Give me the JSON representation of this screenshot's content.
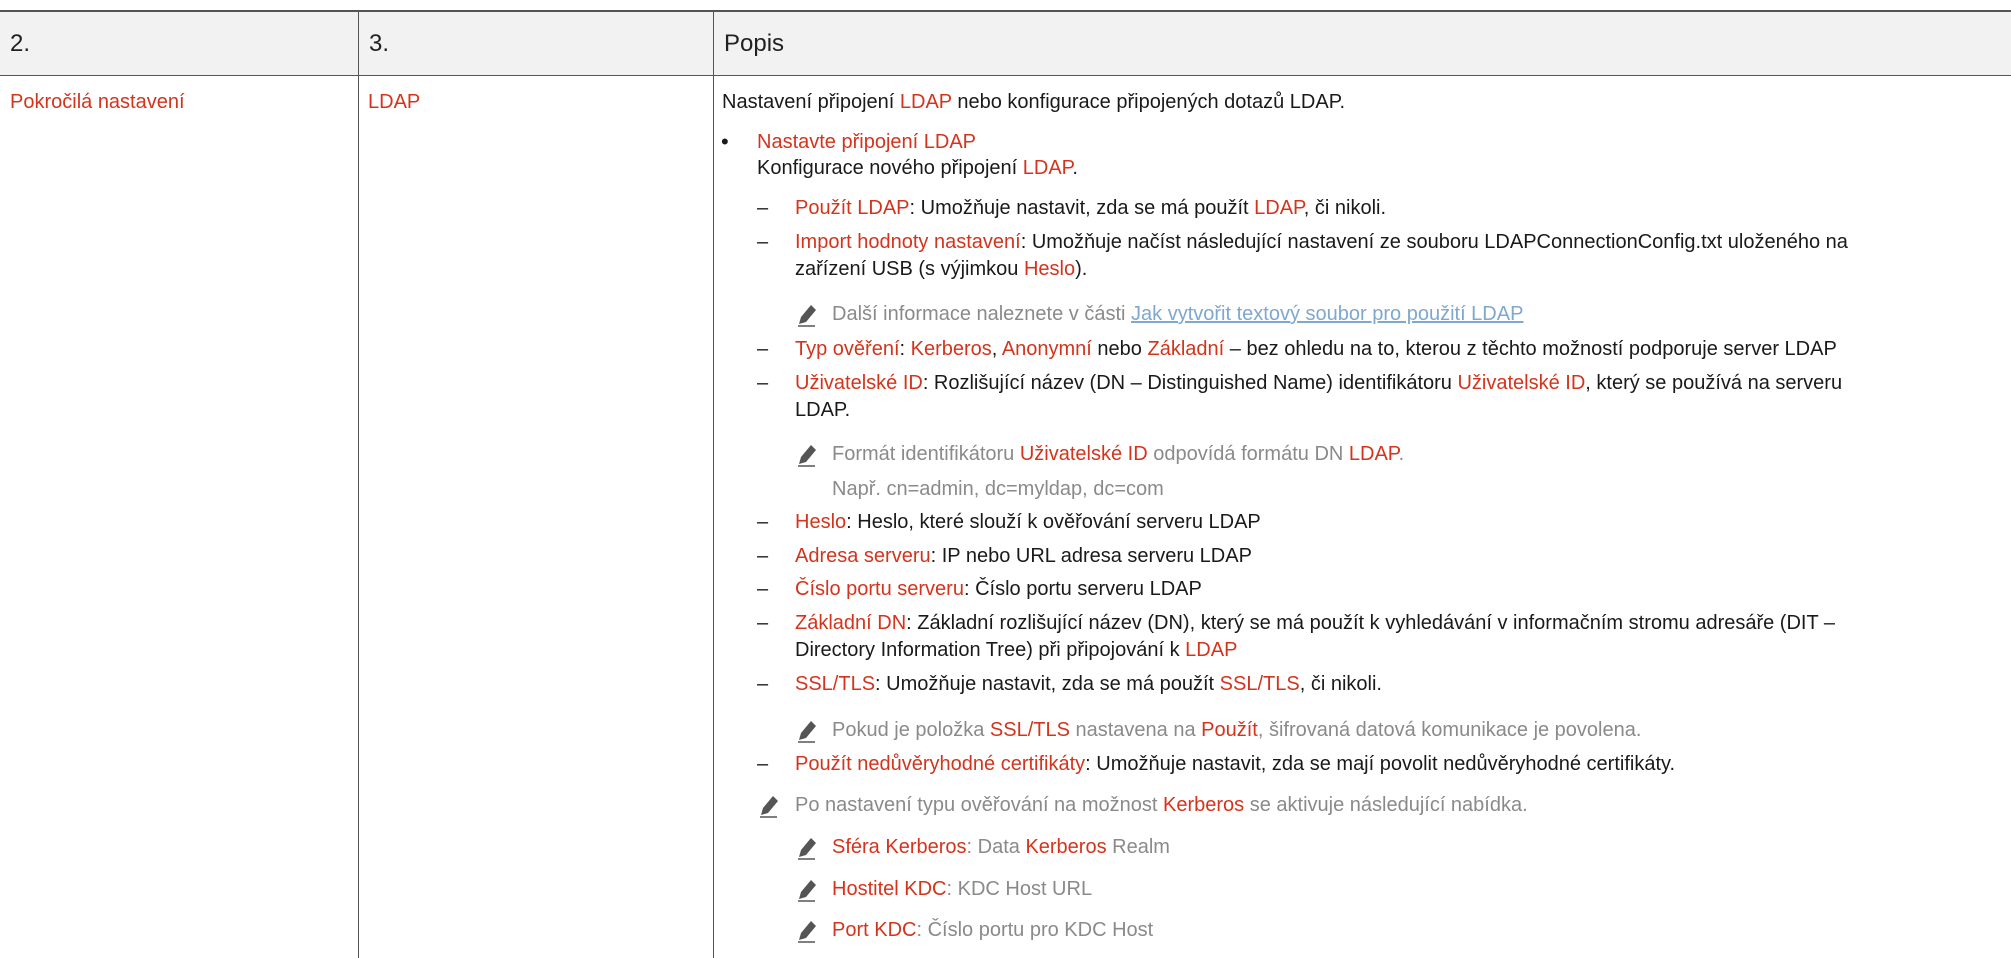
{
  "table": {
    "headers": [
      "2.",
      "3.",
      "Popis"
    ],
    "col1": "Pokročilá nastavení",
    "col2": "LDAP"
  },
  "desc": {
    "intro": {
      "a": "Nastavení připojení ",
      "b": "LDAP",
      "c": " nebo konfigurace připojených dotazů LDAP."
    },
    "bullet_title": "Nastavte připojení LDAP",
    "bullet_sub": {
      "a": "Konfigurace nového připojení ",
      "b": "LDAP",
      "c": "."
    },
    "use_ldap": {
      "a": "Použít LDAP",
      "b": ": Umožňuje nastavit, zda se má použít ",
      "c": "LDAP",
      "d": ", či nikoli."
    },
    "import": {
      "a": "Import hodnoty nastavení",
      "b": ": Umožňuje načíst následující nastavení ze souboru LDAPConnectionConfig.txt uloženého na",
      "c": "zařízení USB (s výjimkou ",
      "d": "Heslo",
      "e": ")."
    },
    "note_more": {
      "a": "Další informace naleznete v části ",
      "link": "Jak vytvořit textový soubor pro použití LDAP"
    },
    "auth": {
      "a": "Typ ověření",
      "b": ": ",
      "c": "Kerberos",
      "d": ", ",
      "e": "Anonymní",
      "f": " nebo ",
      "g": "Základní",
      "h": " – bez ohledu na to, kterou z těchto možností podporuje server LDAP"
    },
    "userid": {
      "a": "Uživatelské ID",
      "b": ": Rozlišující název (DN – Distinguished Name) identifikátoru ",
      "c": "Uživatelské ID",
      "d": ", který se používá na serveru",
      "e": "LDAP."
    },
    "note_format": {
      "a": "Formát identifikátoru ",
      "b": "Uživatelské ID",
      "c": " odpovídá formátu DN ",
      "d": "LDAP",
      "e": ".",
      "example": "Např. cn=admin, dc=myldap, dc=com"
    },
    "password": {
      "a": "Heslo",
      "b": ": Heslo, které slouží k ověřování serveru LDAP"
    },
    "server": {
      "a": "Adresa serveru",
      "b": ": IP nebo URL adresa serveru LDAP"
    },
    "port": {
      "a": "Číslo portu serveru",
      "b": ": Číslo portu serveru LDAP"
    },
    "basedn": {
      "a": "Základní DN",
      "b": ": Základní rozlišující název (DN), který se má použít k vyhledávání v informačním stromu adresáře (DIT –",
      "c": "Directory Information Tree) při připojování k ",
      "d": "LDAP"
    },
    "ssl": {
      "a": "SSL/TLS",
      "b": ": Umožňuje nastavit, zda se má použít ",
      "c": "SSL/TLS",
      "d": ", či nikoli."
    },
    "note_ssl": {
      "a": "Pokud je položka ",
      "b": "SSL/TLS",
      "c": " nastavena na ",
      "d": "Použít",
      "e": ", šifrovaná datová komunikace je povolena."
    },
    "untrusted": {
      "a": "Použít nedůvěryhodné certifikáty",
      "b": ": Umožňuje nastavit, zda se mají povolit nedůvěryhodné certifikáty."
    },
    "note_kerb": {
      "a": "Po nastavení typu ověřování na možnost ",
      "b": "Kerberos",
      "c": " se aktivuje následující nabídka."
    },
    "realm": {
      "a": "Sféra Kerberos",
      "b": ": Data ",
      "c": "Kerberos",
      "d": " Realm"
    },
    "kdc_host": {
      "a": "Hostitel KDC",
      "b": ": KDC Host URL"
    },
    "kdc_port": {
      "a": "Port KDC",
      "b": ": Číslo portu pro KDC Host"
    },
    "dash_glyph": "–",
    "bullet_glyph": "•"
  }
}
